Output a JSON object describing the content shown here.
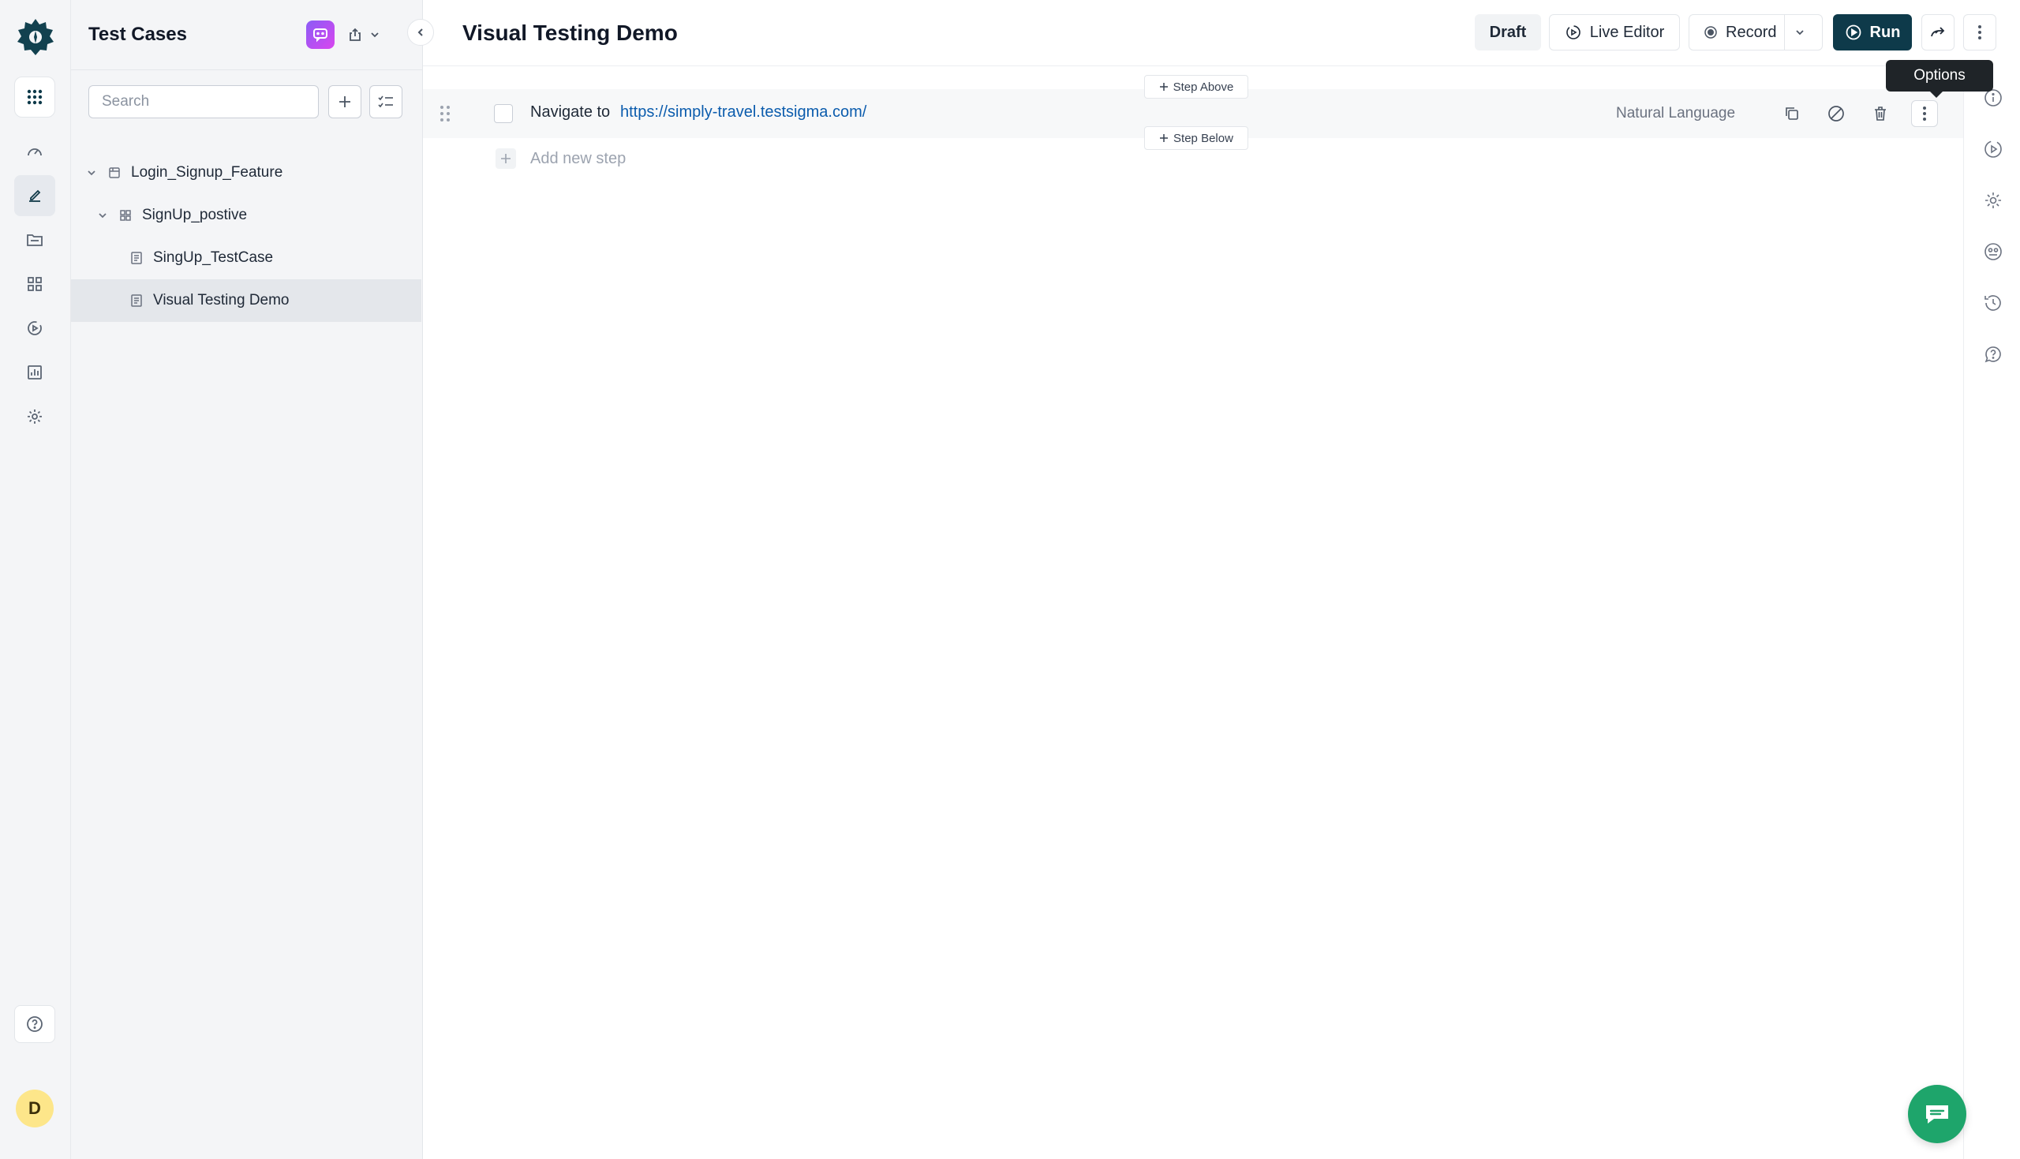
{
  "sidebar_nav": [
    "apps",
    "dashboard",
    "test-cases",
    "test-data",
    "elements",
    "runs",
    "reports",
    "settings"
  ],
  "panel": {
    "title": "Test Cases",
    "search_placeholder": "Search",
    "tree": [
      {
        "label": "Login_Signup_Feature",
        "level": 0,
        "icon": "feature-icon",
        "expanded": true
      },
      {
        "label": "SignUp_postive",
        "level": 1,
        "icon": "scenario-icon",
        "expanded": true
      },
      {
        "label": "SingUp_TestCase",
        "level": 2,
        "icon": "testcase-icon"
      },
      {
        "label": "Visual Testing Demo",
        "level": 2,
        "icon": "testcase-icon",
        "selected": true
      }
    ]
  },
  "user": {
    "avatar_initial": "D"
  },
  "main": {
    "title": "Visual Testing Demo",
    "buttons": {
      "draft": "Draft",
      "live_editor": "Live Editor",
      "record": "Record",
      "run": "Run"
    },
    "tooltip": "Options",
    "step": {
      "action": "Navigate to",
      "url": "https://simply-travel.testsigma.com/",
      "type": "Natural Language",
      "step_above": "Step Above",
      "step_below": "Step Below"
    },
    "add_step": "Add new step"
  },
  "colors": {
    "brand_dark": "#0e3a4a",
    "link": "#0b5cad",
    "chat_fab": "#1ea56b",
    "avatar_bg": "#fde68a"
  }
}
